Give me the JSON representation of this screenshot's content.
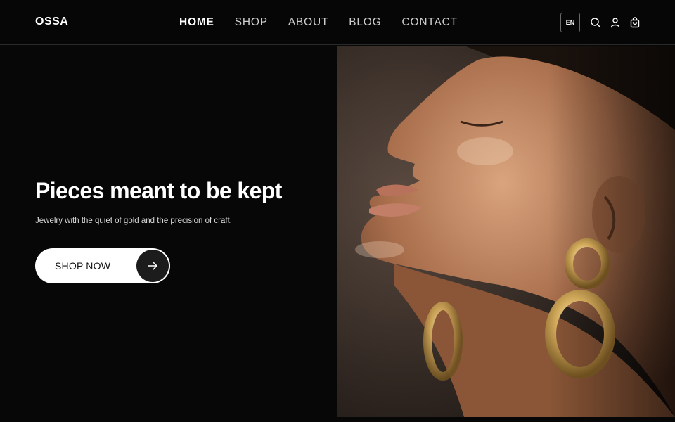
{
  "brand": {
    "name": "OSSA"
  },
  "nav": {
    "items": [
      {
        "label": "HOME",
        "active": true
      },
      {
        "label": "SHOP",
        "active": false
      },
      {
        "label": "ABOUT",
        "active": false
      },
      {
        "label": "BLOG",
        "active": false
      },
      {
        "label": "CONTACT",
        "active": false
      }
    ]
  },
  "header": {
    "language": "EN",
    "icons": [
      "search-icon",
      "user-icon",
      "cart-icon"
    ]
  },
  "hero": {
    "headline": "Pieces meant to be kept",
    "subline": "Jewelry with the quiet of gold and the precision of craft.",
    "cta_label": "SHOP NOW",
    "cta_icon": "arrow-right-icon",
    "image": "woman-with-gold-earrings"
  },
  "colors": {
    "background": "#070707",
    "text": "#ffffff",
    "button_bg": "#ffffff",
    "button_circle": "#1c1c1c"
  }
}
